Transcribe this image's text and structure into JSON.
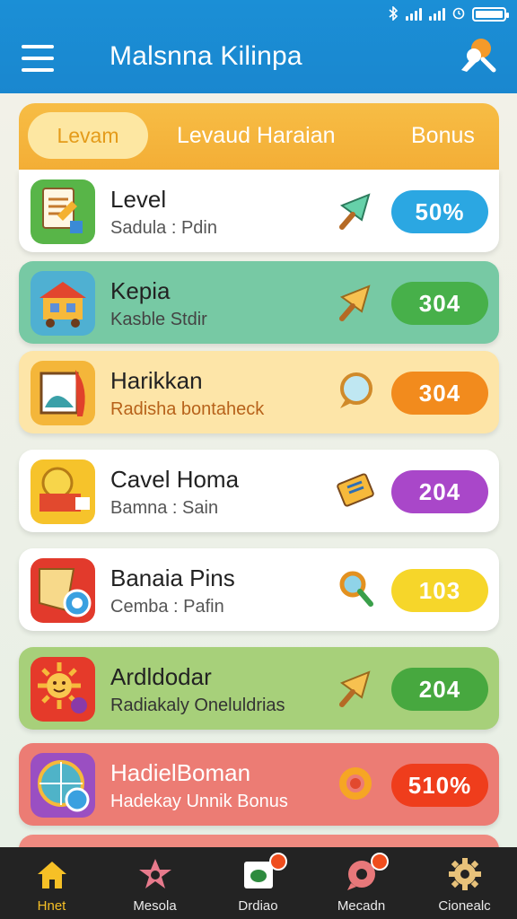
{
  "app": {
    "title": "Malsnna Kilinpa"
  },
  "status_bar": {
    "icons": [
      "bluetooth-icon",
      "signal-icon",
      "signal-icon",
      "alarm-icon",
      "battery-icon"
    ]
  },
  "tabs": [
    {
      "label": "Levam",
      "active": true
    },
    {
      "label": "Levaud Haraian",
      "active": false
    },
    {
      "label": "Bonus",
      "active": false
    }
  ],
  "rows": [
    {
      "title": "Level",
      "subtitle": "Sadula : Pdin",
      "badge": "50%",
      "badge_color": "#2ba7e2",
      "bg": "#ffffff",
      "subtitle_color": "#555555",
      "icon": "document-icon",
      "mini_icon": "arrow-icon"
    },
    {
      "title": "Kepia",
      "subtitle": "Kasble Stdir",
      "badge": "304",
      "badge_color": "#47b04a",
      "bg": "#77c9a4",
      "subtitle_color": "#444444",
      "icon": "house-cart-icon",
      "mini_icon": "arrow-icon"
    },
    {
      "title": "Harikkan",
      "subtitle": "Radisha bontaheck",
      "badge": "304",
      "badge_color": "#f28b1d",
      "bg": "#fde5a8",
      "subtitle_color": "#b7621a",
      "icon": "window-icon",
      "mini_icon": "bubble-icon"
    },
    {
      "title": "Cavel Homa",
      "subtitle": "Bamna : Sain",
      "badge": "204",
      "badge_color": "#a947c9",
      "bg": "#ffffff",
      "subtitle_color": "#555555",
      "icon": "coin-box-icon",
      "mini_icon": "ticket-icon"
    },
    {
      "title": "Banaia Pins",
      "subtitle": "Cemba : Pafin",
      "badge": "103",
      "badge_color": "#f6d62a",
      "bg": "#ffffff",
      "subtitle_color": "#555555",
      "icon": "medal-icon",
      "mini_icon": "key-icon"
    },
    {
      "title": "Ardldodar",
      "subtitle": "Radiakaly Oneluldrias",
      "badge": "204",
      "badge_color": "#47a83f",
      "bg": "#a7d07a",
      "subtitle_color": "#333333",
      "icon": "sun-icon",
      "mini_icon": "arrow-icon"
    },
    {
      "title": "HadielBoman",
      "subtitle": "Hadekay Unnik Bonus",
      "badge": "510%",
      "badge_color": "#ef3d1c",
      "bg": "#ec7c74",
      "subtitle_color": "#ffffff",
      "icon": "globe-icon",
      "mini_icon": "ring-icon"
    }
  ],
  "bottom_nav": [
    {
      "label": "Hnet",
      "icon": "home-icon",
      "active": true
    },
    {
      "label": "Mesola",
      "icon": "star-icon",
      "active": false
    },
    {
      "label": "Drdiao",
      "icon": "card-icon",
      "active": false
    },
    {
      "label": "Mecadn",
      "icon": "chat-icon",
      "active": false
    },
    {
      "label": "Cionealc",
      "icon": "gear-icon",
      "active": false
    }
  ],
  "colors": {
    "appbar": "#1b8fd6",
    "tabs": "#f3ae36",
    "nav_active": "#f6c026"
  }
}
